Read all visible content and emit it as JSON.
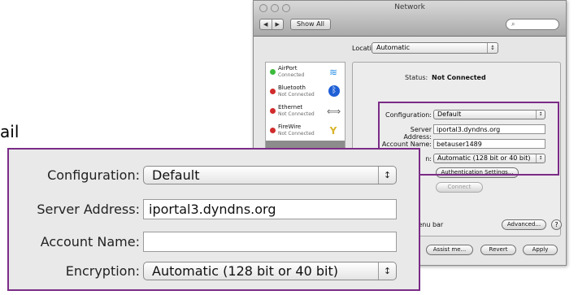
{
  "background": {
    "stray_text": "ail"
  },
  "window": {
    "title": "Network",
    "nav": {
      "back": "◀",
      "forward": "▶"
    },
    "show_all": "Show All",
    "search_placeholder": "",
    "location": {
      "label": "Location:",
      "value": "Automatic"
    },
    "services": [
      {
        "name": "AirPort",
        "status": "Connected",
        "status_color": "#3cba3c",
        "icon": "wifi-icon",
        "glyph": "≋",
        "icon_color": "#2a8ee6"
      },
      {
        "name": "Bluetooth",
        "status": "Not Connected",
        "status_color": "#d12c2c",
        "icon": "bluetooth-icon",
        "glyph": "ᛒ",
        "icon_color": "#ffffff"
      },
      {
        "name": "Ethernet",
        "status": "Not Connected",
        "status_color": "#d12c2c",
        "icon": "ethernet-icon",
        "glyph": "⟺",
        "icon_color": "#666666"
      },
      {
        "name": "FireWire",
        "status": "Not Connected",
        "status_color": "#d12c2c",
        "icon": "firewire-icon",
        "glyph": "Y",
        "icon_color": "#d9b42a"
      }
    ],
    "status": {
      "label": "Status:",
      "value": "Not Connected"
    },
    "form": {
      "configuration": {
        "label": "Configuration:",
        "value": "Default"
      },
      "server_address": {
        "label": "Server Address:",
        "value": "iportal3.dyndns.org"
      },
      "account_name": {
        "label": "Account Name:",
        "value": "betauser1489"
      },
      "encryption": {
        "label": "n:",
        "value": "Automatic (128 bit or 40 bit)"
      },
      "auth_button": "Authentication Settings...",
      "connect_button": "Connect"
    },
    "menubar_text": "s in menu bar",
    "advanced_button": "Advanced...",
    "help_button": "?",
    "footer": {
      "assist": "Assist me...",
      "revert": "Revert",
      "apply": "Apply"
    }
  },
  "zoom": {
    "configuration": {
      "label": "Configuration:",
      "value": "Default"
    },
    "server_address": {
      "label": "Server Address:",
      "value": "iportal3.dyndns.org"
    },
    "account_name": {
      "label": "Account Name:",
      "value": ""
    },
    "encryption": {
      "label": "Encryption:",
      "value": "Automatic (128 bit or 40 bit)"
    }
  },
  "colors": {
    "highlight": "#7b2c87"
  }
}
